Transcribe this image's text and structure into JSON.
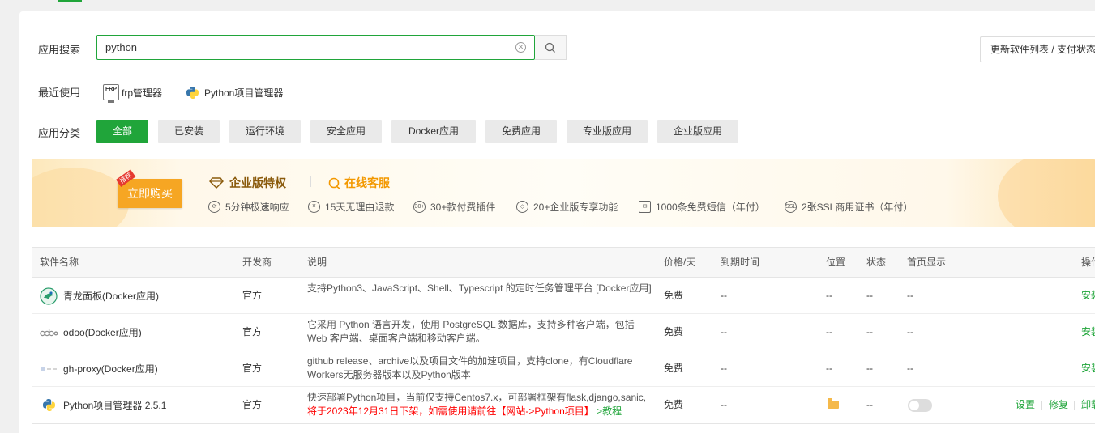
{
  "search": {
    "label": "应用搜索",
    "value": "python",
    "clear_icon": "close-circle-icon",
    "search_icon": "search-icon"
  },
  "update_button": "更新软件列表 / 支付状态",
  "recent": {
    "label": "最近使用",
    "items": [
      {
        "label": "frp管理器",
        "icon": "frp-icon"
      },
      {
        "label": "Python项目管理器",
        "icon": "python-icon"
      }
    ]
  },
  "categories": {
    "label": "应用分类",
    "items": [
      "全部",
      "已安装",
      "运行环境",
      "安全应用",
      "Docker应用",
      "免费应用",
      "专业版应用",
      "企业版应用"
    ],
    "active": "全部"
  },
  "banner": {
    "buy_label": "立即购买",
    "buy_tag": "推荐",
    "enterprise_title": "企业版特权",
    "service_title": "在线客服",
    "features": [
      "5分钟极速响应",
      "15天无理由退款",
      "30+款付费插件",
      "20+企业版专享功能",
      "1000条免费短信（年付）",
      "2张SSL商用证书（年付）"
    ]
  },
  "table": {
    "headers": [
      "软件名称",
      "开发商",
      "说明",
      "价格/天",
      "到期时间",
      "位置",
      "状态",
      "首页显示",
      "操作"
    ],
    "rows": [
      {
        "name": "青龙面板(Docker应用)",
        "dev": "官方",
        "desc": "支持Python3、JavaScript、Shell、Typescript 的定时任务管理平台 [Docker应用]",
        "price": "免费",
        "expire": "--",
        "location": "--",
        "status": "--",
        "home": "--",
        "op": "安装"
      },
      {
        "name": "odoo(Docker应用)",
        "dev": "官方",
        "desc": "它采用 Python 语言开发，使用 PostgreSQL 数据库，支持多种客户端，包括 Web 客户端、桌面客户端和移动客户端。",
        "price": "免费",
        "expire": "--",
        "location": "--",
        "status": "--",
        "home": "--",
        "op": "安装"
      },
      {
        "name": "gh-proxy(Docker应用)",
        "dev": "官方",
        "desc": "github release、archive以及项目文件的加速项目，支持clone，有Cloudflare Workers无服务器版本以及Python版本",
        "price": "免费",
        "expire": "--",
        "location": "--",
        "status": "--",
        "home": "--",
        "op": "安装"
      },
      {
        "name": "Python项目管理器 2.5.1",
        "dev": "官方",
        "desc_normal": "快速部署Python项目，当前仅支持Centos7.x，可部署框架有flask,django,sanic,",
        "desc_red": "将于2023年12月31日下架，如需使用请前往【网站->Python项目】",
        "desc_link": " >教程",
        "price": "免费",
        "expire": "--",
        "location_icon": "folder-icon",
        "status": "--",
        "home_toggle": "off",
        "ops": [
          "设置",
          "修复",
          "卸载"
        ]
      }
    ]
  }
}
